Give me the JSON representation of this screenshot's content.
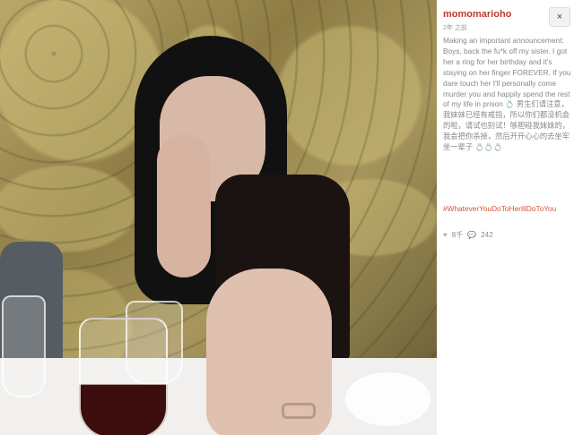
{
  "post": {
    "username": "momomarioho",
    "timestamp": "2年 之前",
    "close_icon": "×",
    "caption": "Making an important announcement: Boys, back the fu*k off my sister. I got her a ring for her birthday and it's staying on her finger FOREVER. If you dare touch her I'll personally come murder you and happily spend the rest of my life in prison 💍 男生们请注意，我妹妹已经有戒指，所以你们都没机会的啦，请试也别试！够胆碰我妹妹的，我会把你杀掉，然后开开心心的去坐牢坐一辈子 💍💍💍",
    "hashtag": "#WhateverYouDoToHerIllDoToYou",
    "likes_icon": "heart-icon",
    "likes": "8千",
    "comments_icon": "comment-icon",
    "comments": "242"
  },
  "colors": {
    "username": "#c0392b",
    "hashtag": "#d2543a",
    "muted_text": "#888888"
  }
}
